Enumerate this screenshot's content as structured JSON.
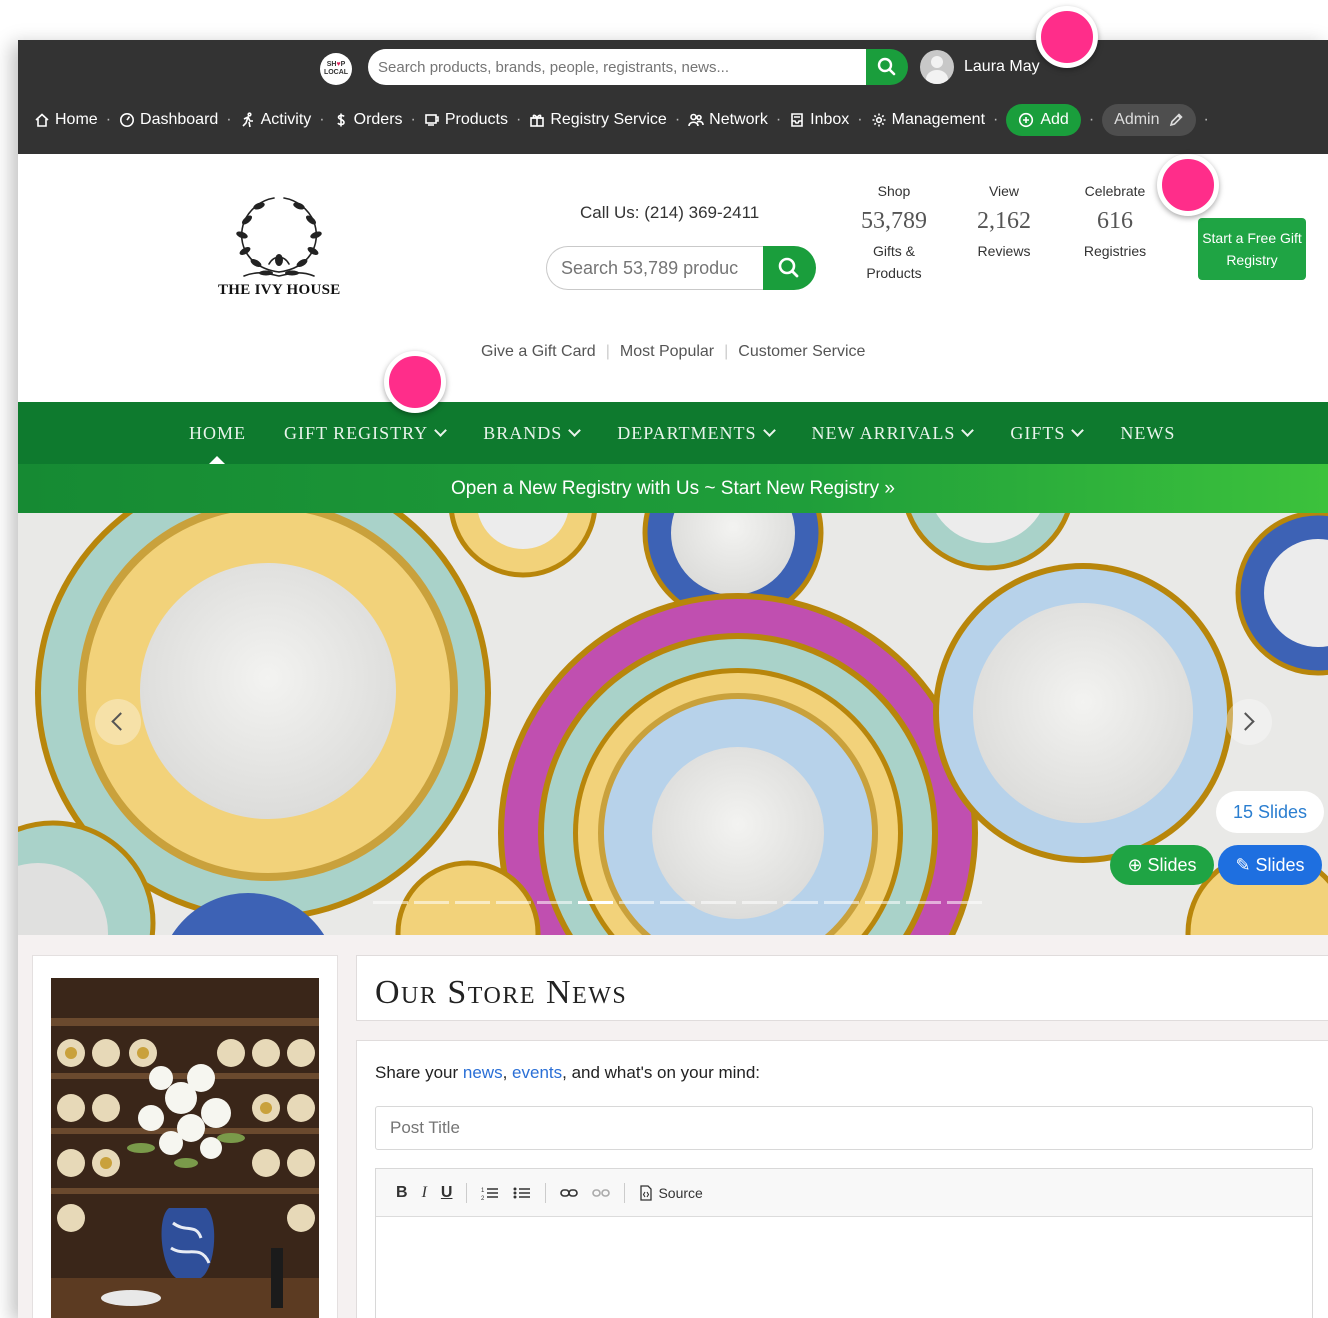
{
  "admin_bar": {
    "logo_text": "SHOP LOCAL",
    "search_placeholder": "Search products, brands, people, registrants, news...",
    "user_name": "Laura May",
    "nav": [
      {
        "label": "Home",
        "icon": "home-icon"
      },
      {
        "label": "Dashboard",
        "icon": "dashboard-icon"
      },
      {
        "label": "Activity",
        "icon": "activity-icon"
      },
      {
        "label": "Orders",
        "icon": "dollar-icon"
      },
      {
        "label": "Products",
        "icon": "products-icon"
      },
      {
        "label": "Registry Service",
        "icon": "gift-icon"
      },
      {
        "label": "Network",
        "icon": "network-icon"
      },
      {
        "label": "Inbox",
        "icon": "inbox-icon"
      },
      {
        "label": "Management",
        "icon": "gear-icon"
      }
    ],
    "add_label": "Add",
    "admin_label": "Admin"
  },
  "store": {
    "name": "THE IVY HOUSE",
    "call_us": "Call Us: (214) 369-2411",
    "search_placeholder": "Search 53,789 produc",
    "stats": [
      {
        "label": "Shop",
        "value": "53,789",
        "sub": "Gifts & Products"
      },
      {
        "label": "View",
        "value": "2,162",
        "sub": "Reviews"
      },
      {
        "label": "Celebrate",
        "value": "616",
        "sub": "Registries"
      }
    ],
    "cta": "Start a Free Gift Registry",
    "links": [
      "Give a Gift Card",
      "Most Popular",
      "Customer Service"
    ]
  },
  "main_nav": [
    {
      "label": "Home",
      "caret": false
    },
    {
      "label": "Gift Registry",
      "caret": true
    },
    {
      "label": "Brands",
      "caret": true
    },
    {
      "label": "Departments",
      "caret": true
    },
    {
      "label": "New Arrivals",
      "caret": true
    },
    {
      "label": "Gifts",
      "caret": true
    },
    {
      "label": "News",
      "caret": false
    }
  ],
  "promo": "Open a New Registry with Us ~ Start New Registry »",
  "hero": {
    "slides_count": "15 Slides",
    "add_slides": "Slides",
    "edit_slides": "Slides",
    "total_dots": 15,
    "active_dot": 5
  },
  "news": {
    "heading": "Our Store News",
    "prompt_prefix": "Share your ",
    "prompt_link1": "news",
    "prompt_comma": ", ",
    "prompt_link2": "events",
    "prompt_suffix": ", and what's on your mind:",
    "title_placeholder": "Post Title",
    "toolbar": {
      "bold": "B",
      "italic": "I",
      "underline": "U",
      "source": "Source"
    }
  },
  "colors": {
    "admin_bar_bg": "#333333",
    "brand_green": "#1a9e3c",
    "nav_green": "#0e7a2e",
    "link_blue": "#2a6fd6",
    "marker_pink": "#ff2d8a"
  }
}
